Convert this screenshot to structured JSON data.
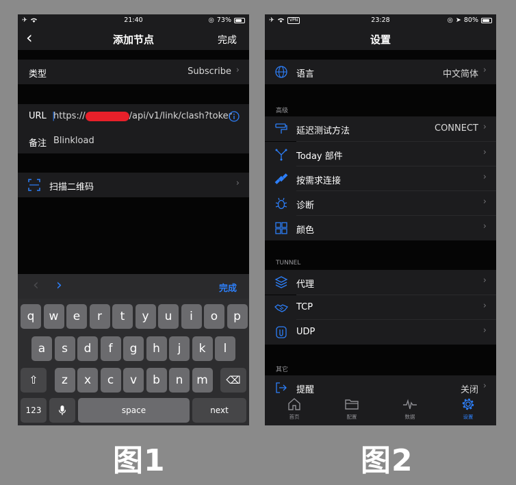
{
  "figure1": {
    "status": {
      "time": "21:40",
      "battery": "73%",
      "battery_level": 0.73
    },
    "nav": {
      "back": "‹",
      "title": "添加节点",
      "done": "完成"
    },
    "type_row": {
      "label": "类型",
      "value": "Subscribe"
    },
    "url_row": {
      "label": "URL",
      "prefix": "https://",
      "suffix": "/api/v1/link/clash?toker"
    },
    "note_row": {
      "label": "备注",
      "value": "Blinkload"
    },
    "scan_row": {
      "label": "扫描二维码"
    },
    "kb_toolbar": {
      "done": "完成"
    },
    "keyboard": {
      "row1": [
        "q",
        "w",
        "e",
        "r",
        "t",
        "y",
        "u",
        "i",
        "o",
        "p"
      ],
      "row2": [
        "a",
        "s",
        "d",
        "f",
        "g",
        "h",
        "j",
        "k",
        "l"
      ],
      "row3": [
        "z",
        "x",
        "c",
        "v",
        "b",
        "n",
        "m"
      ],
      "numbers": "123",
      "space": "space",
      "next": "next"
    },
    "caption": "图1"
  },
  "figure2": {
    "status": {
      "time": "23:28",
      "battery": "80%",
      "vpn": "VPN",
      "battery_level": 0.8
    },
    "nav": {
      "title": "设置"
    },
    "language_row": {
      "label": "语言",
      "value": "中文简体"
    },
    "advanced_header": "高级",
    "advanced": [
      {
        "label": "延迟测试方法",
        "value": "CONNECT",
        "icon": "ruler-icon"
      },
      {
        "label": "Today 部件",
        "value": "",
        "icon": "widget-icon"
      },
      {
        "label": "按需求连接",
        "value": "",
        "icon": "satellite-icon"
      },
      {
        "label": "诊断",
        "value": "",
        "icon": "bug-icon"
      },
      {
        "label": "颜色",
        "value": "",
        "icon": "grid-icon"
      }
    ],
    "tunnel_header": "TUNNEL",
    "tunnel": [
      {
        "label": "代理",
        "icon": "layers-icon"
      },
      {
        "label": "TCP",
        "icon": "handshake-icon"
      },
      {
        "label": "UDP",
        "icon": "udp-icon"
      }
    ],
    "other_header": "其它",
    "reminder_row": {
      "label": "提醒",
      "value": "关闭"
    },
    "tabs": [
      {
        "label": "首页",
        "icon": "home-icon"
      },
      {
        "label": "配置",
        "icon": "folder-icon"
      },
      {
        "label": "数据",
        "icon": "pulse-icon"
      },
      {
        "label": "设置",
        "icon": "gear-icon"
      }
    ],
    "caption": "图2"
  },
  "colors": {
    "accent": "#2d7ff9",
    "redaction": "#e8202a",
    "cell": "#1c1c1e",
    "background": "#050505"
  }
}
